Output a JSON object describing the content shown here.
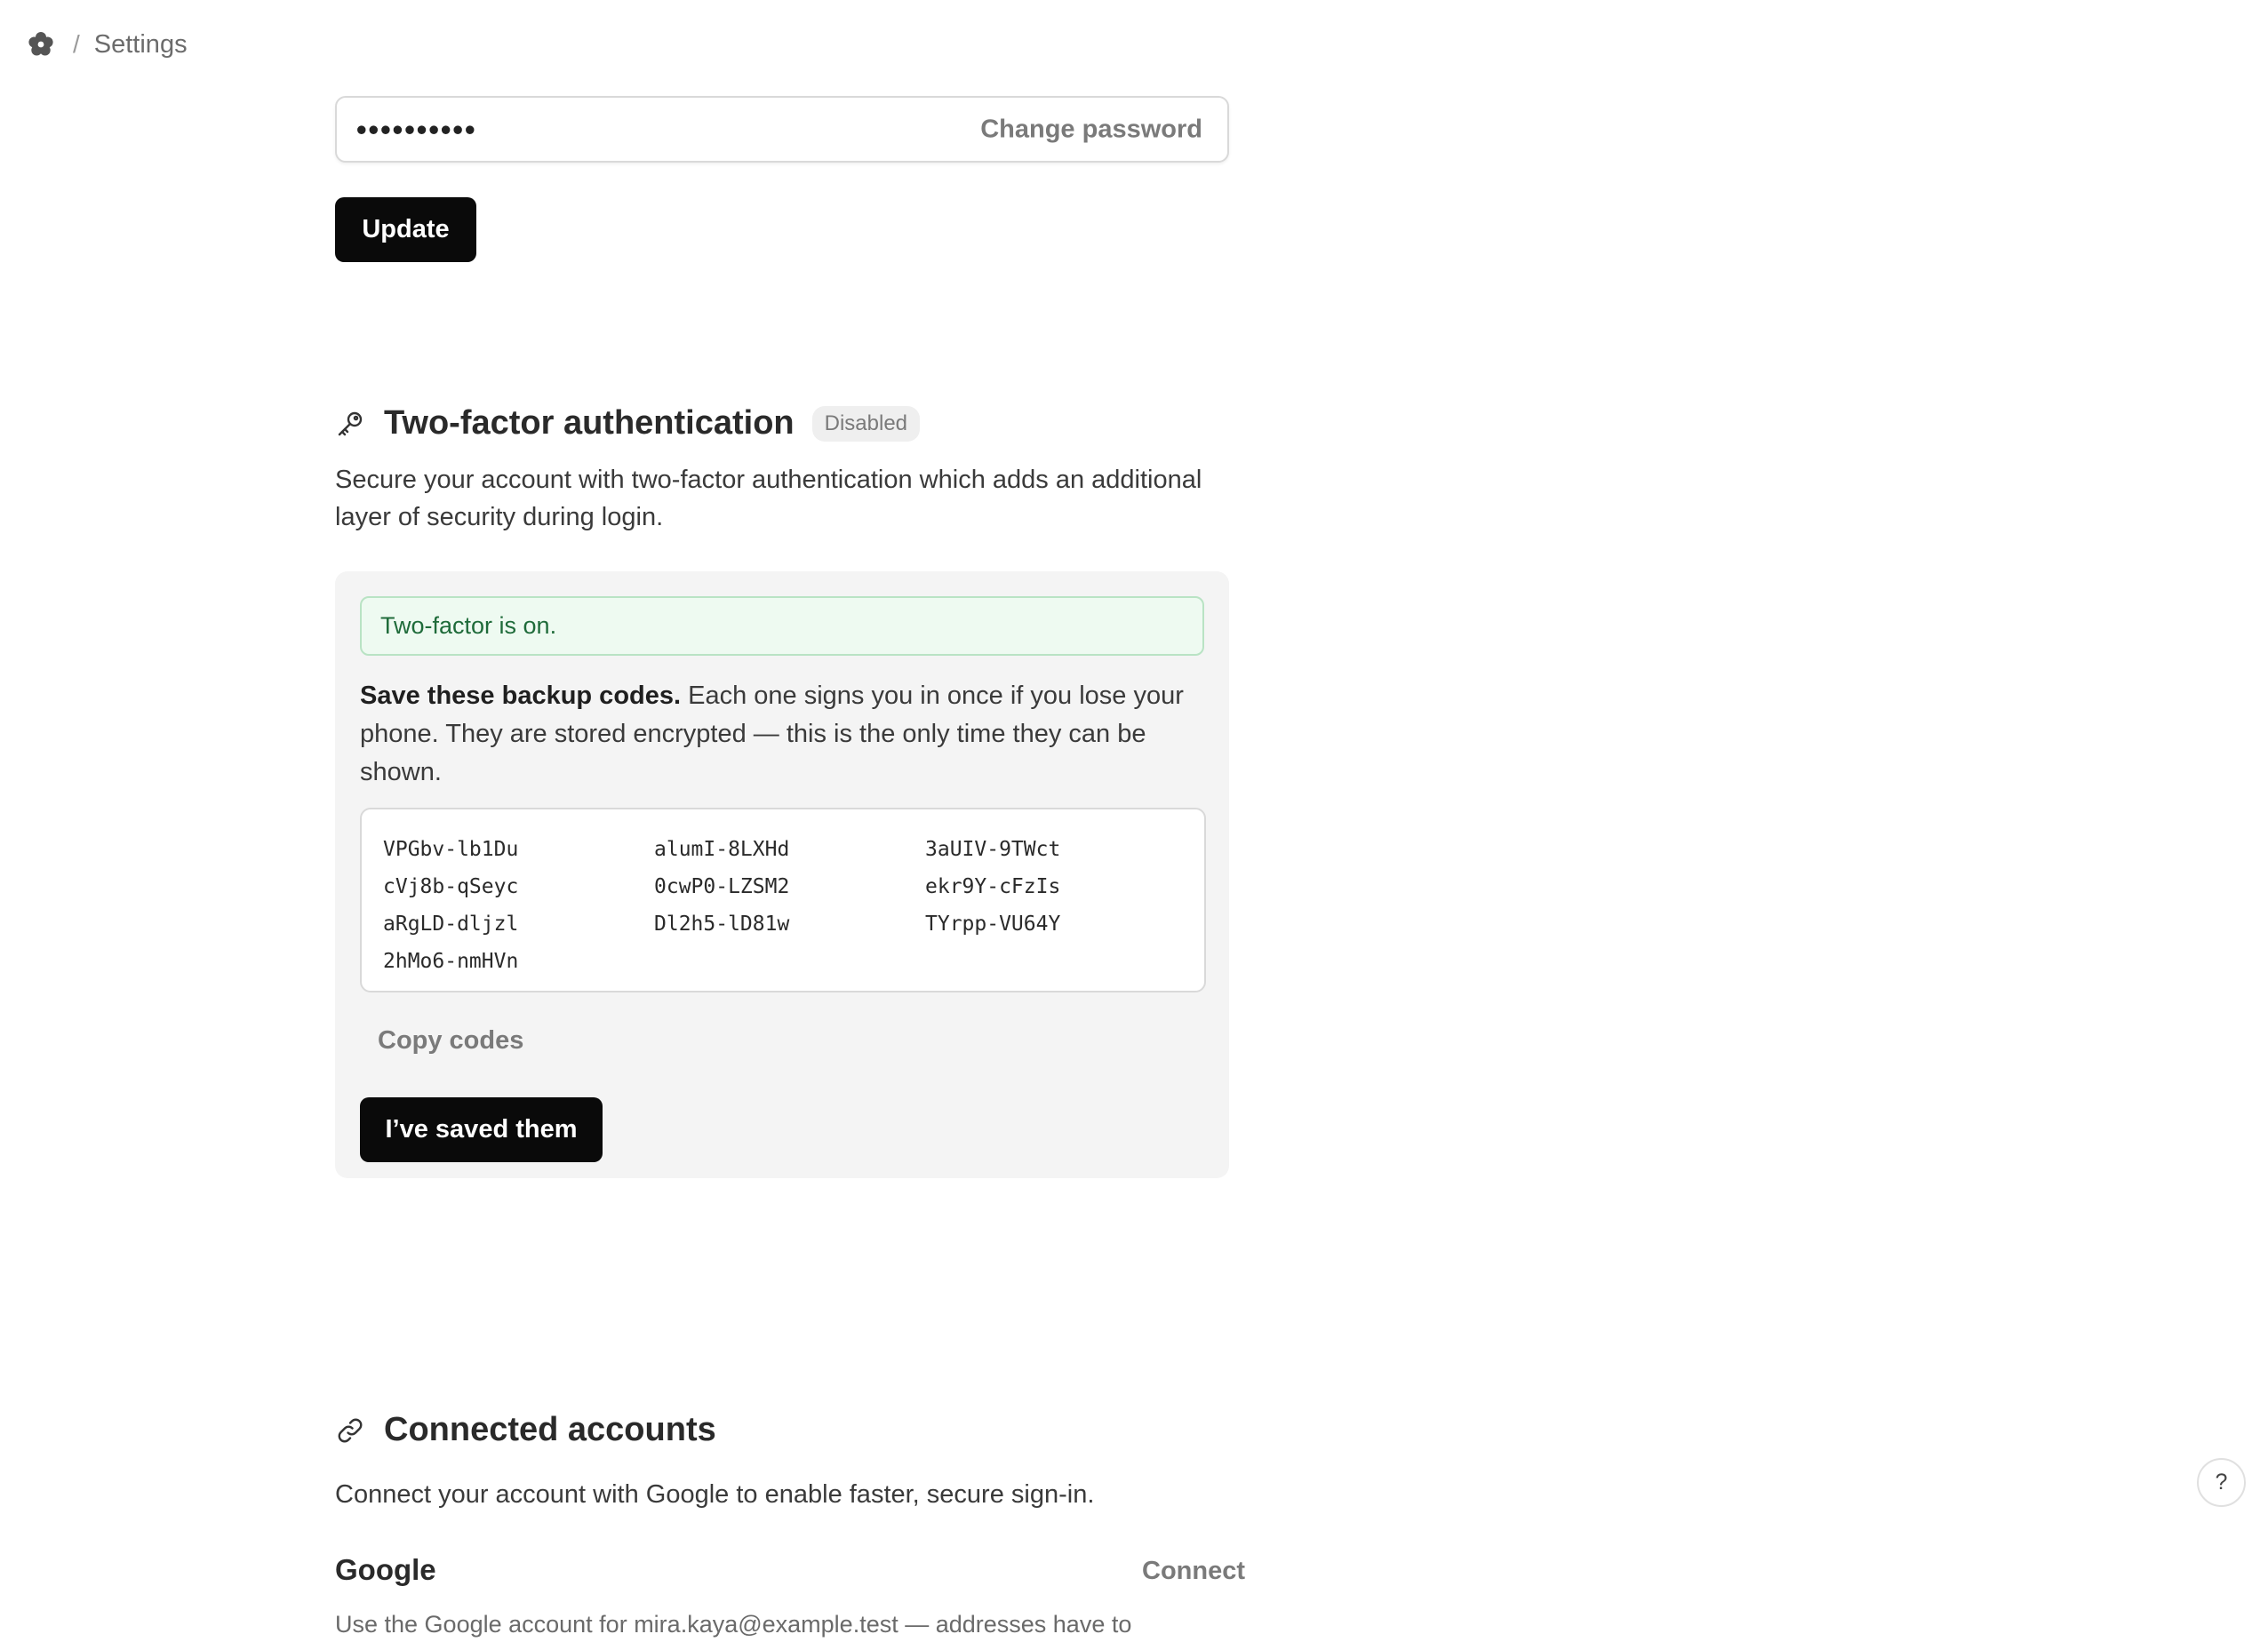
{
  "breadcrumb": {
    "logo_icon": "flower-logo-icon",
    "separator": "/",
    "current": "Settings"
  },
  "password": {
    "masked_value": "••••••••••",
    "change_label": "Change password",
    "update_label": "Update"
  },
  "two_factor": {
    "icon": "key-icon",
    "title": "Two-factor authentication",
    "status_badge": "Disabled",
    "description": "Secure your account with two-factor authentication which adds an additional layer of security during login.",
    "alert": "Two-factor is on.",
    "backup_heading": "Save these backup codes.",
    "backup_body": " Each one signs you in once if you lose your phone. They are stored encrypted — this is the only time they can be shown.",
    "codes": [
      "VPGbv-lb1Du",
      "alumI-8LXHd",
      "3aUIV-9TWct",
      "cVj8b-qSeyc",
      "0cwP0-LZSM2",
      "ekr9Y-cFzIs",
      "aRgLD-dljzl",
      "Dl2h5-lD81w",
      "TYrpp-VU64Y",
      "2hMo6-nmHVn"
    ],
    "copy_label": "Copy codes",
    "saved_label": "I’ve saved them"
  },
  "connected_accounts": {
    "icon": "link-icon",
    "title": "Connected accounts",
    "description": "Connect your account with Google to enable faster, secure sign-in.",
    "google": {
      "title": "Google",
      "connect_label": "Connect",
      "note": "Use the Google account for mira.kaya@example.test — addresses have to"
    }
  },
  "help": {
    "label": "?"
  }
}
